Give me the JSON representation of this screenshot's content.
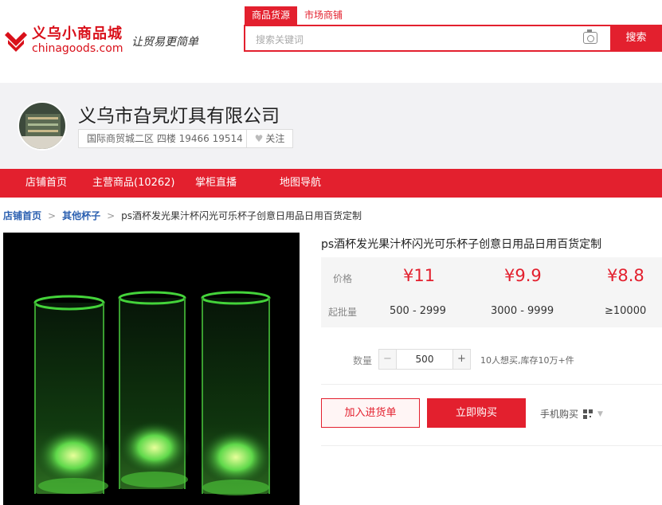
{
  "header": {
    "logo_cn": "义乌小商品城",
    "logo_en": "chinagoods.com",
    "slogan": "让贸易更简单",
    "search_tabs": [
      {
        "label": "商品货源",
        "active": true
      },
      {
        "label": "市场商铺",
        "active": false
      }
    ],
    "search_placeholder": "搜索关键词",
    "search_button": "搜索"
  },
  "shop": {
    "name": "义乌市旮旯灯具有限公司",
    "address": "国际商贸城二区 四楼 19466 19514",
    "follow_label": "关注"
  },
  "nav": {
    "items": [
      {
        "label": "店铺首页"
      },
      {
        "label": "主营商品(10262)"
      },
      {
        "label": "掌柜直播"
      },
      {
        "label": "地图导航"
      }
    ]
  },
  "breadcrumb": {
    "items": [
      "店铺首页",
      "其他杯子"
    ],
    "current": "ps酒杯发光果汁杯闪光可乐杯子创意日用品日用百货定制"
  },
  "product": {
    "title": "ps酒杯发光果汁杯闪光可乐杯子创意日用品日用百货定制",
    "price_label": "价格",
    "batch_label": "起批量",
    "tiers": [
      {
        "price": "¥11",
        "range": "500 - 2999"
      },
      {
        "price": "¥9.9",
        "range": "3000 - 9999"
      },
      {
        "price": "¥8.8",
        "range": "≥10000"
      }
    ],
    "qty_label": "数量",
    "qty_value": "500",
    "qty_note": "10人想买,库存10万+件",
    "add_to_cart": "加入进货单",
    "buy_now": "立即购买",
    "mobile_buy": "手机购买"
  },
  "colors": {
    "brand": "#e3202e",
    "link": "#2a5fb0"
  }
}
